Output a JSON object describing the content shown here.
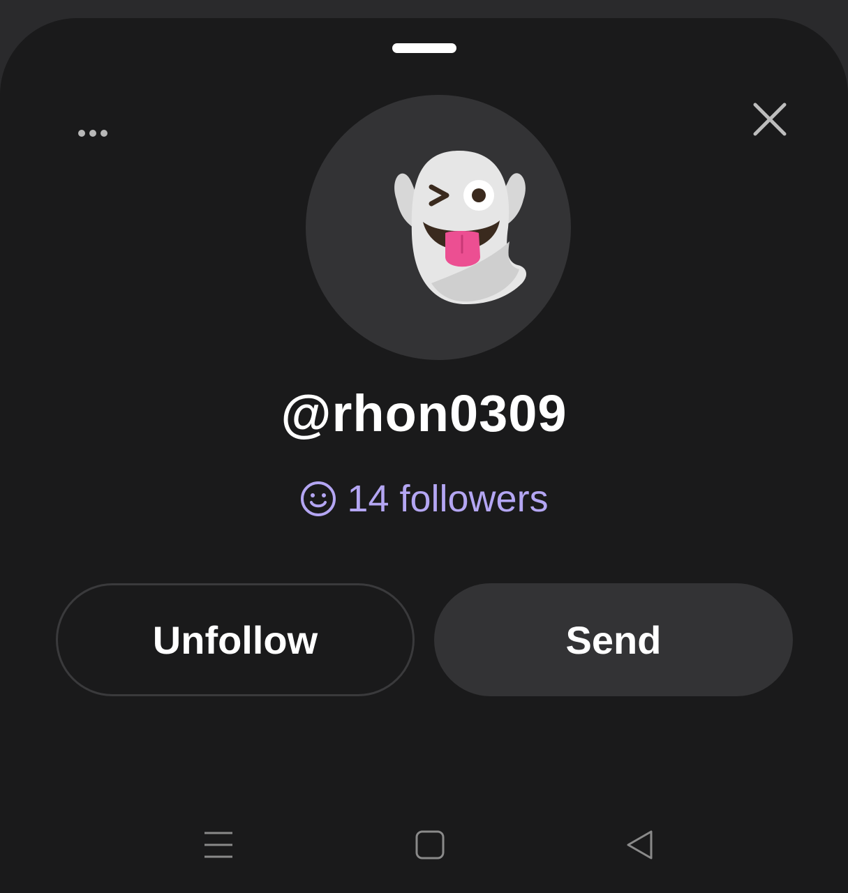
{
  "profile": {
    "username": "@rhon0309",
    "followers_text": "14 followers",
    "avatar_icon": "ghost-emoji-icon"
  },
  "header": {
    "more_icon": "more-horizontal-icon",
    "close_icon": "close-icon"
  },
  "actions": {
    "unfollow_label": "Unfollow",
    "send_label": "Send"
  },
  "nav_bar": {
    "recents_icon": "menu-lines-icon",
    "home_icon": "home-square-icon",
    "back_icon": "back-triangle-icon"
  },
  "colors": {
    "sheet_background": "#1a1a1b",
    "accent": "#b4a6f3",
    "button_fill": "#333335"
  }
}
